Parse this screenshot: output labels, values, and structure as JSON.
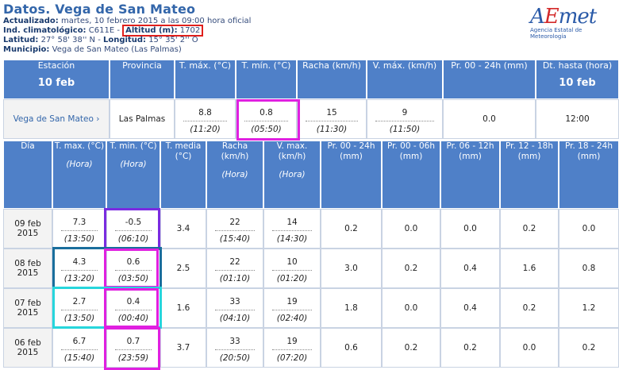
{
  "header": {
    "title": "Datos. Vega de San Mateo",
    "updated_label": "Actualizado:",
    "updated_value": "martes, 10 febrero 2015 a las 09:00 hora oficial",
    "climat_label": "Ind. climatológico:",
    "climat_value": "C611E",
    "altitude_label": "Altitud (m):",
    "altitude_value": "1702",
    "lat_label": "Latitud:",
    "lat_value": "27° 58' 38'' N",
    "lon_label": "Longitud:",
    "lon_value": "15° 35' 2'' O",
    "mun_label": "Municipio:",
    "mun_value": "Vega de San Mateo (Las Palmas)"
  },
  "logo": {
    "wordmark_a": "A",
    "wordmark_e": "E",
    "wordmark_rest": "met",
    "subtitle": "Agencia Estatal de Meteorología"
  },
  "current": {
    "headers": [
      "Estación",
      "Provincia",
      "T. máx. (°C)",
      "T. mín. (°C)",
      "Racha (km/h)",
      "V. máx. (km/h)",
      "Pr. 00 - 24h (mm)",
      "Dt. hasta (hora)"
    ],
    "station_date": "10 feb",
    "dt_date": "10 feb",
    "station": "Vega de San Mateo",
    "province": "Las Palmas",
    "tmax": "8.8",
    "tmax_h": "(11:20)",
    "tmin": "0.8",
    "tmin_h": "(05:50)",
    "racha": "15",
    "racha_h": "(11:30)",
    "vmax": "9",
    "vmax_h": "(11:50)",
    "pr": "0.0",
    "dt": "12:00"
  },
  "daily": {
    "headers": [
      "Día",
      "T. max. (°C)",
      "T. min. (°C)",
      "T. media (°C)",
      "Racha (km/h)",
      "V. max. (km/h)",
      "Pr. 00 - 24h (mm)",
      "Pr. 00 - 06h (mm)",
      "Pr. 06 - 12h (mm)",
      "Pr. 12 - 18h (mm)",
      "Pr. 18 - 24h (mm)"
    ],
    "hora": "(Hora)",
    "rows": [
      {
        "day": "09 feb 2015",
        "tmax": "7.3",
        "tmax_h": "(13:50)",
        "tmin": "-0.5",
        "tmin_h": "(06:10)",
        "tmed": "3.4",
        "racha": "22",
        "racha_h": "(15:40)",
        "vmax": "14",
        "vmax_h": "(14:30)",
        "p24": "0.2",
        "p06": "0.0",
        "p12": "0.0",
        "p18": "0.2",
        "p24b": "0.0"
      },
      {
        "day": "08 feb 2015",
        "tmax": "4.3",
        "tmax_h": "(13:20)",
        "tmin": "0.6",
        "tmin_h": "(03:50)",
        "tmed": "2.5",
        "racha": "22",
        "racha_h": "(01:10)",
        "vmax": "10",
        "vmax_h": "(01:20)",
        "p24": "3.0",
        "p06": "0.2",
        "p12": "0.4",
        "p18": "1.6",
        "p24b": "0.8"
      },
      {
        "day": "07 feb 2015",
        "tmax": "2.7",
        "tmax_h": "(13:50)",
        "tmin": "0.4",
        "tmin_h": "(00:40)",
        "tmed": "1.6",
        "racha": "33",
        "racha_h": "(04:10)",
        "vmax": "19",
        "vmax_h": "(02:40)",
        "p24": "1.8",
        "p06": "0.0",
        "p12": "0.4",
        "p18": "0.2",
        "p24b": "1.2"
      },
      {
        "day": "06 feb 2015",
        "tmax": "6.7",
        "tmax_h": "(15:40)",
        "tmin": "0.7",
        "tmin_h": "(23:59)",
        "tmed": "3.7",
        "racha": "33",
        "racha_h": "(20:50)",
        "vmax": "19",
        "vmax_h": "(07:20)",
        "p24": "0.6",
        "p06": "0.2",
        "p12": "0.2",
        "p18": "0.0",
        "p24b": "0.2"
      }
    ]
  },
  "colors": {
    "header_blue": "#4f80c8",
    "title_blue": "#3366aa",
    "box_magenta": "#e020e0",
    "box_purple": "#7a2be0",
    "box_teal": "#1a6e9c",
    "box_cyan": "#27d6dc",
    "box_red": "#e0201c"
  }
}
